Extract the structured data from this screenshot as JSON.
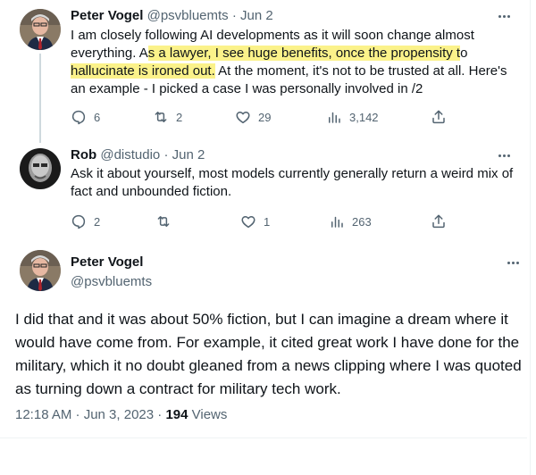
{
  "thread": [
    {
      "name": "Peter Vogel",
      "handle": "@psvbluemts",
      "dot": "·",
      "date": "Jun 2",
      "text_before": "I am closely following AI developments as it will soon change almost everything. A",
      "text_highlight": "s a lawyer, I see huge benefits, once the propensity t",
      "text_middle": "o ",
      "text_highlight2": "hallucinate is ironed out.",
      "text_after": " At the moment, it's not to be trusted at all. Here's an example - I picked a case I was personally involved in /2",
      "replies": "6",
      "retweets": "2",
      "likes": "29",
      "views": "3,142"
    },
    {
      "name": "Rob",
      "handle": "@distudio",
      "dot": "·",
      "date": "Jun 2",
      "text": "Ask it about yourself, most models currently generally return a weird mix of fact and unbounded fiction.",
      "replies": "2",
      "retweets": "",
      "likes": "1",
      "views": "263"
    }
  ],
  "main": {
    "name": "Peter Vogel",
    "handle": "@psvbluemts",
    "text": "I did that and it was about 50% fiction, but I can imagine a dream where it would have come from. For example, it cited great work I have done for the military, which it no doubt gleaned from a news clipping where I was quoted as turning down a contract for military tech work.",
    "time": "12:18 AM · Jun 3, 2023 · ",
    "views_count": "194",
    "views_label": " Views"
  },
  "icons": {
    "reply": "reply-icon",
    "retweet": "retweet-icon",
    "like": "heart-icon",
    "views": "views-chart-icon",
    "share": "share-icon",
    "more": "more-icon"
  },
  "colors": {
    "text": "#0f1419",
    "secondary": "#536471",
    "highlight": "#fbf28a",
    "divider": "#eff3f4"
  }
}
